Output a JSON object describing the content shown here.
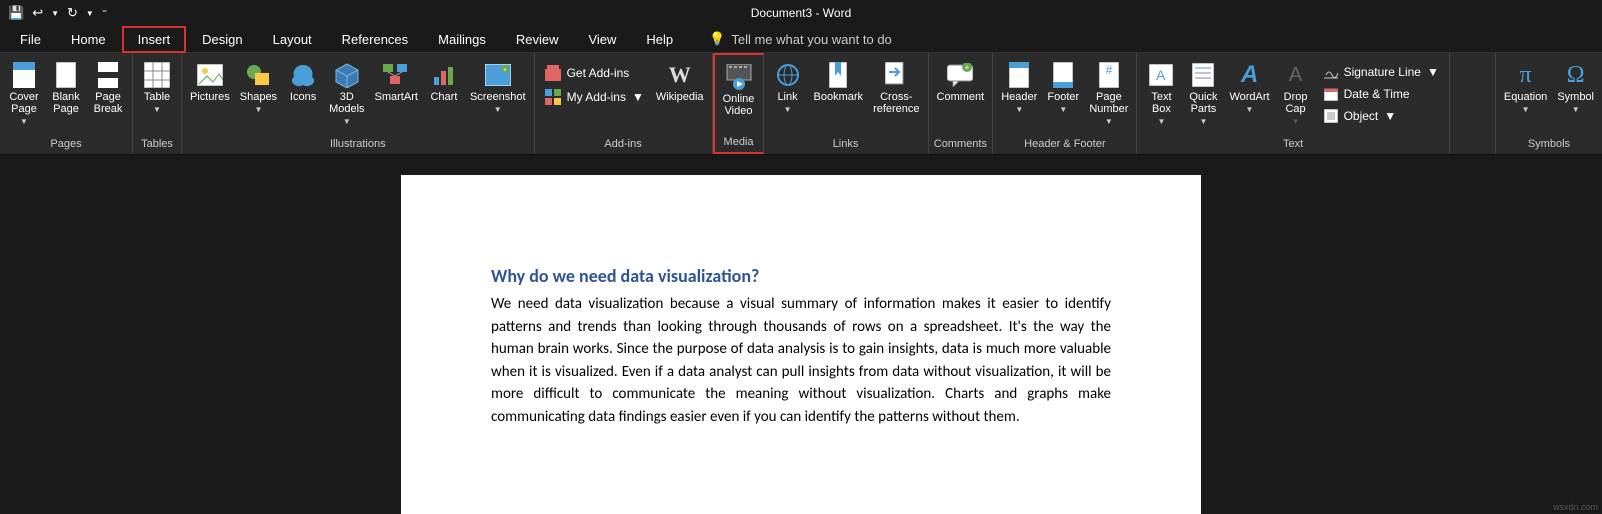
{
  "app": {
    "title": "Document3 - Word"
  },
  "qat": {
    "save": "Save",
    "undo": "Undo",
    "redo": "Redo"
  },
  "tabs": {
    "file": "File",
    "home": "Home",
    "insert": "Insert",
    "design": "Design",
    "layout": "Layout",
    "references": "References",
    "mailings": "Mailings",
    "review": "Review",
    "view": "View",
    "help": "Help",
    "tellme": "Tell me what you want to do"
  },
  "ribbon": {
    "pages": {
      "label": "Pages",
      "cover": "Cover\nPage",
      "blank": "Blank\nPage",
      "break": "Page\nBreak"
    },
    "tables": {
      "label": "Tables",
      "table": "Table"
    },
    "illustrations": {
      "label": "Illustrations",
      "pictures": "Pictures",
      "shapes": "Shapes",
      "icons": "Icons",
      "models": "3D\nModels",
      "smartart": "SmartArt",
      "chart": "Chart",
      "screenshot": "Screenshot"
    },
    "addins": {
      "label": "Add-ins",
      "get": "Get Add-ins",
      "my": "My Add-ins",
      "wikipedia": "Wikipedia"
    },
    "media": {
      "label": "Media",
      "online": "Online\nVideo"
    },
    "links": {
      "label": "Links",
      "link": "Link",
      "bookmark": "Bookmark",
      "crossref": "Cross-\nreference"
    },
    "comments": {
      "label": "Comments",
      "comment": "Comment"
    },
    "hf": {
      "label": "Header & Footer",
      "header": "Header",
      "footer": "Footer",
      "pagenum": "Page\nNumber"
    },
    "text": {
      "label": "Text",
      "textbox": "Text\nBox",
      "quick": "Quick\nParts",
      "wordart": "WordArt",
      "dropcap": "Drop\nCap",
      "sig": "Signature Line",
      "date": "Date & Time",
      "object": "Object"
    },
    "symbols": {
      "label": "Symbols",
      "equation": "Equation",
      "symbol": "Symbol"
    }
  },
  "document": {
    "heading": "Why do we need data visualization?",
    "body": "We need data visualization because a visual summary of information makes it easier to identify patterns and trends than looking through thousands of rows on a spreadsheet. It's the way the human brain works. Since the purpose of data analysis is to gain insights, data is much more valuable when it is visualized. Even if a data analyst can pull insights from data without visualization, it will be more difficult to communicate the meaning without visualization. Charts and graphs make communicating data findings easier even if you can identify the patterns without them."
  },
  "watermark": "wsxdn.com"
}
